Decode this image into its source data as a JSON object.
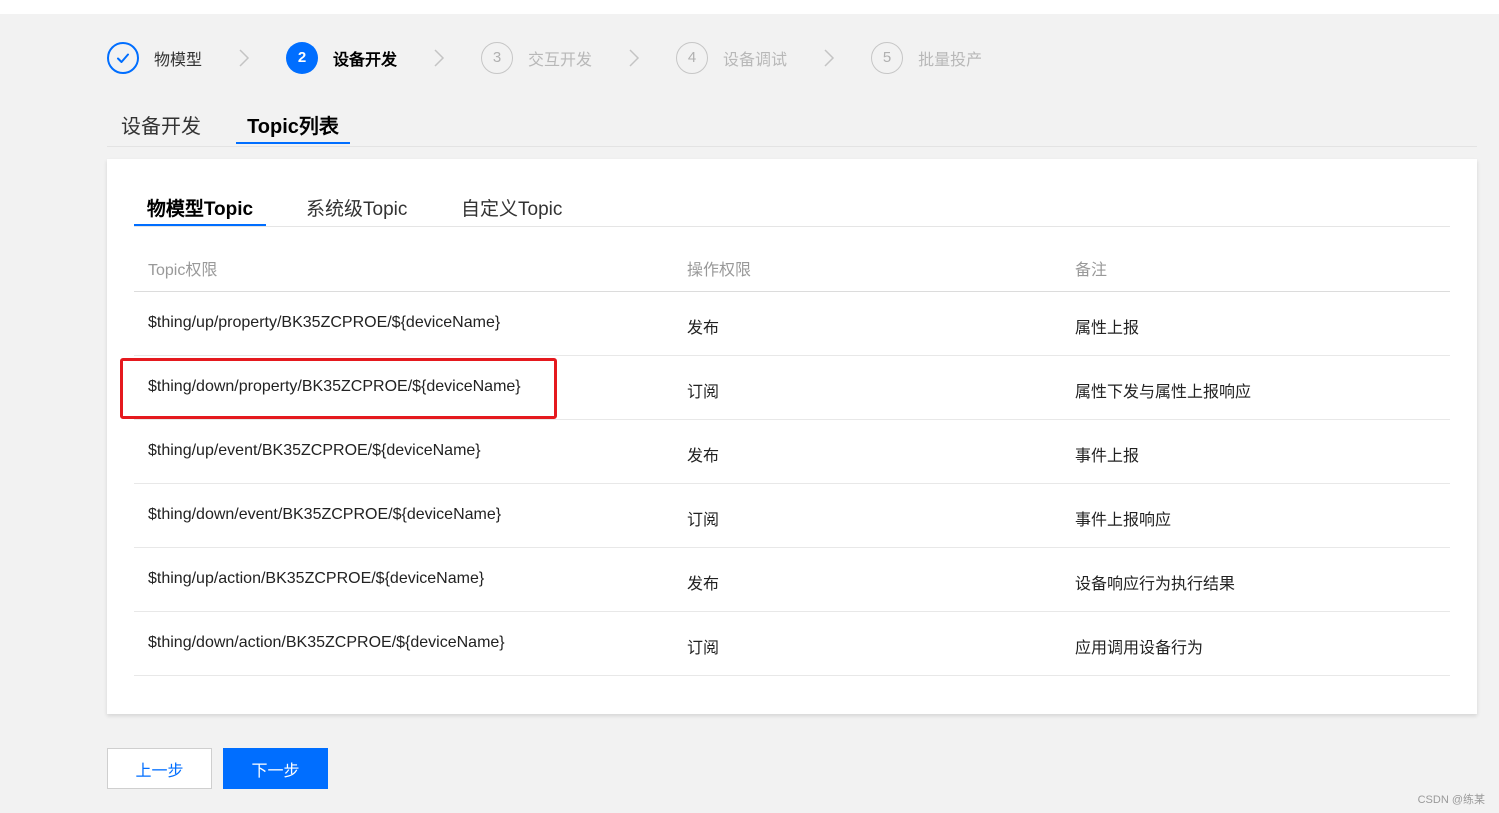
{
  "colors": {
    "primary": "#006eff",
    "highlight": "#e5191e",
    "background": "#f2f2f2"
  },
  "stepper": {
    "steps": [
      {
        "marker": "check-icon",
        "label": "物模型",
        "state": "done"
      },
      {
        "marker": "2",
        "label": "设备开发",
        "state": "active"
      },
      {
        "marker": "3",
        "label": "交互开发",
        "state": "pending"
      },
      {
        "marker": "4",
        "label": "设备调试",
        "state": "pending"
      },
      {
        "marker": "5",
        "label": "批量投产",
        "state": "pending"
      }
    ],
    "separator_icon": "chevron-right-icon"
  },
  "top_tabs": [
    {
      "label": "设备开发",
      "active": false
    },
    {
      "label": "Topic列表",
      "active": true
    }
  ],
  "sub_tabs": [
    {
      "label": "物模型Topic",
      "active": true
    },
    {
      "label": "系统级Topic",
      "active": false
    },
    {
      "label": "自定义Topic",
      "active": false
    }
  ],
  "table": {
    "headers": [
      "Topic权限",
      "操作权限",
      "备注"
    ],
    "rows": [
      [
        "$thing/up/property/BK35ZCPROE/${deviceName}",
        "发布",
        "属性上报"
      ],
      [
        "$thing/down/property/BK35ZCPROE/${deviceName}",
        "订阅",
        "属性下发与属性上报响应"
      ],
      [
        "$thing/up/event/BK35ZCPROE/${deviceName}",
        "发布",
        "事件上报"
      ],
      [
        "$thing/down/event/BK35ZCPROE/${deviceName}",
        "订阅",
        "事件上报响应"
      ],
      [
        "$thing/up/action/BK35ZCPROE/${deviceName}",
        "发布",
        "设备响应行为执行结果"
      ],
      [
        "$thing/down/action/BK35ZCPROE/${deviceName}",
        "订阅",
        "应用调用设备行为"
      ]
    ],
    "highlighted_row": 1
  },
  "buttons": {
    "prev": "上一步",
    "next": "下一步"
  },
  "watermark": "CSDN @练某"
}
